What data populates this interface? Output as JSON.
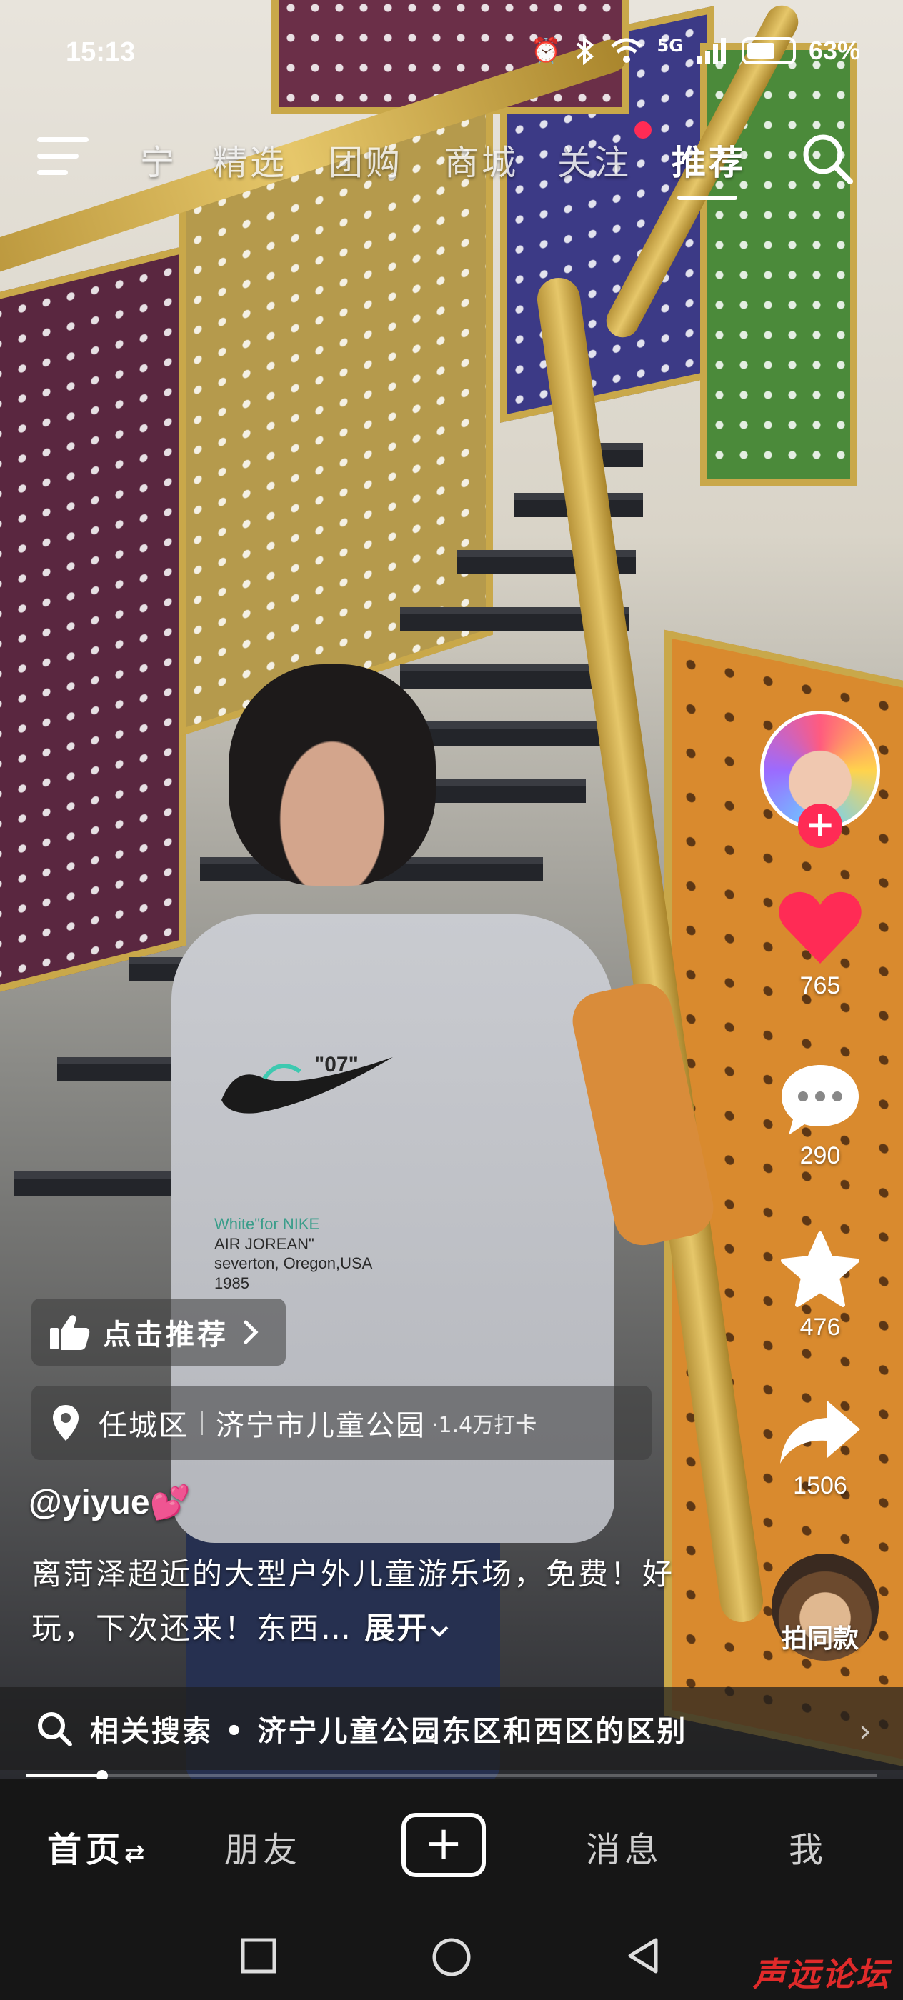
{
  "status_bar": {
    "time": "15:13",
    "network": "5G",
    "battery_percent": "63%",
    "battery_level": 0.63
  },
  "top_nav": {
    "tabs": [
      {
        "label": "宁"
      },
      {
        "label": "精选"
      },
      {
        "label": "团购"
      },
      {
        "label": "商城"
      },
      {
        "label": "关注"
      },
      {
        "label": "推荐"
      }
    ],
    "active_tab": "推荐"
  },
  "actions": {
    "likes": "765",
    "comments": "290",
    "favorites": "476",
    "shares": "1506",
    "same_style_label": "拍同款",
    "like_color": "#ff2b55"
  },
  "overlay": {
    "recommend_label": "点击推荐",
    "location_district": "任城区",
    "location_place": "济宁市儿童公园",
    "location_checkins": "·1.4万打卡",
    "author": "@yiyue",
    "description": "离菏泽超近的大型户外儿童游乐场，免费！好玩，下次还来！东西…",
    "expand_label": "展开"
  },
  "related_search": {
    "text": "相关搜索 • 济宁儿童公园东区和西区的区别"
  },
  "progress": {
    "fraction": 0.09
  },
  "bottom_nav": {
    "home": "首页",
    "friends": "朋友",
    "messages": "消息",
    "me": "我"
  },
  "shirt_print": {
    "number": "\"07\"",
    "line1": "White\"for NIKE",
    "line2": "AIR JOREAN\"",
    "line3": "severton, Oregon,USA",
    "line4": "1985"
  },
  "watermark": "声远论坛"
}
